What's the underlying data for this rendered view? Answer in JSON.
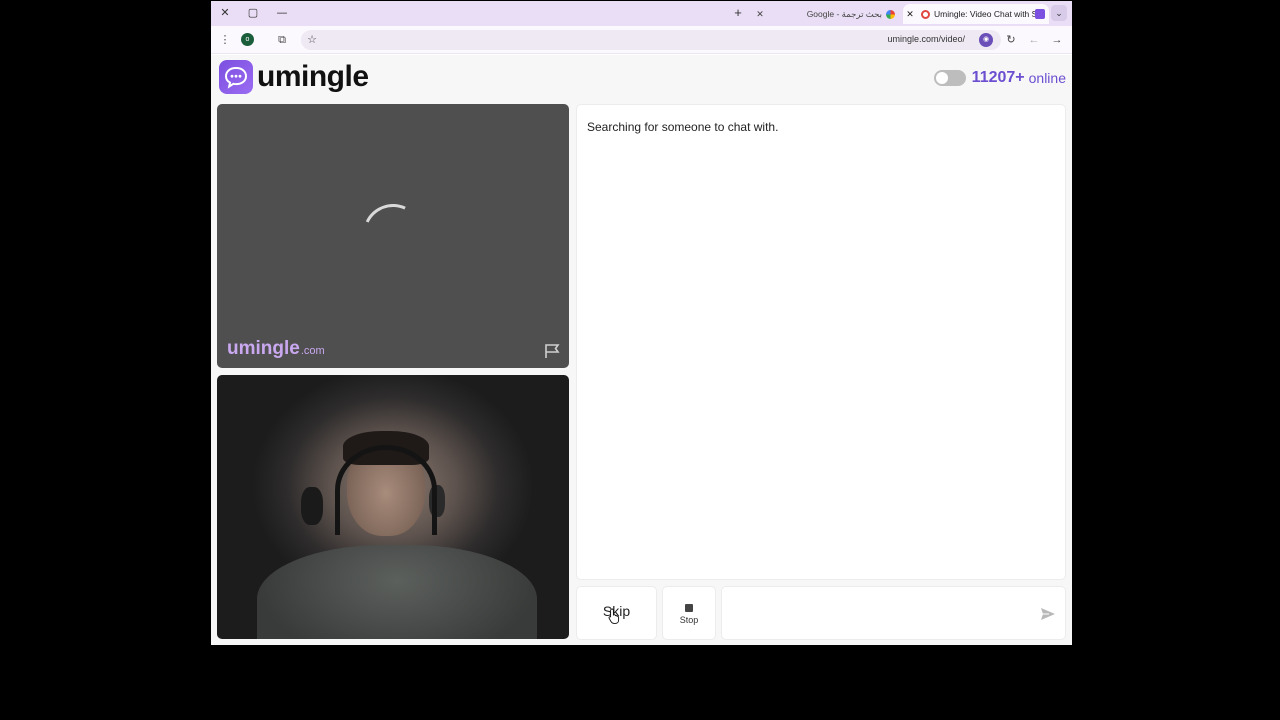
{
  "browser": {
    "window_controls": {
      "close": "✕",
      "maximize": "▢",
      "minimize": "—"
    },
    "new_tab": "+",
    "tabs": [
      {
        "title": "Google - بحث ترجمة",
        "active": false
      },
      {
        "title": "Umingle: Video Chat with St",
        "active": true
      }
    ],
    "tab_search": "⌄",
    "toolbar": {
      "menu": "⋮",
      "profile_initial": "o",
      "extensions": "⧉",
      "bookmark": "☆",
      "reload": "↻",
      "back": "←",
      "forward": "→"
    },
    "url": "umingle.com/video/"
  },
  "site": {
    "logo_text": "umingle",
    "online_count": "11207+",
    "online_label": "online",
    "watermark_brand": "umingle",
    "watermark_tld": ".com"
  },
  "chat": {
    "status": "Searching for someone to chat with."
  },
  "controls": {
    "skip_label": "Skip",
    "stop_label": "Stop",
    "message_placeholder": ""
  },
  "colors": {
    "accent": "#6c4fd1",
    "tab_strip": "#e9def5",
    "video_bg": "#4f4f4f"
  }
}
